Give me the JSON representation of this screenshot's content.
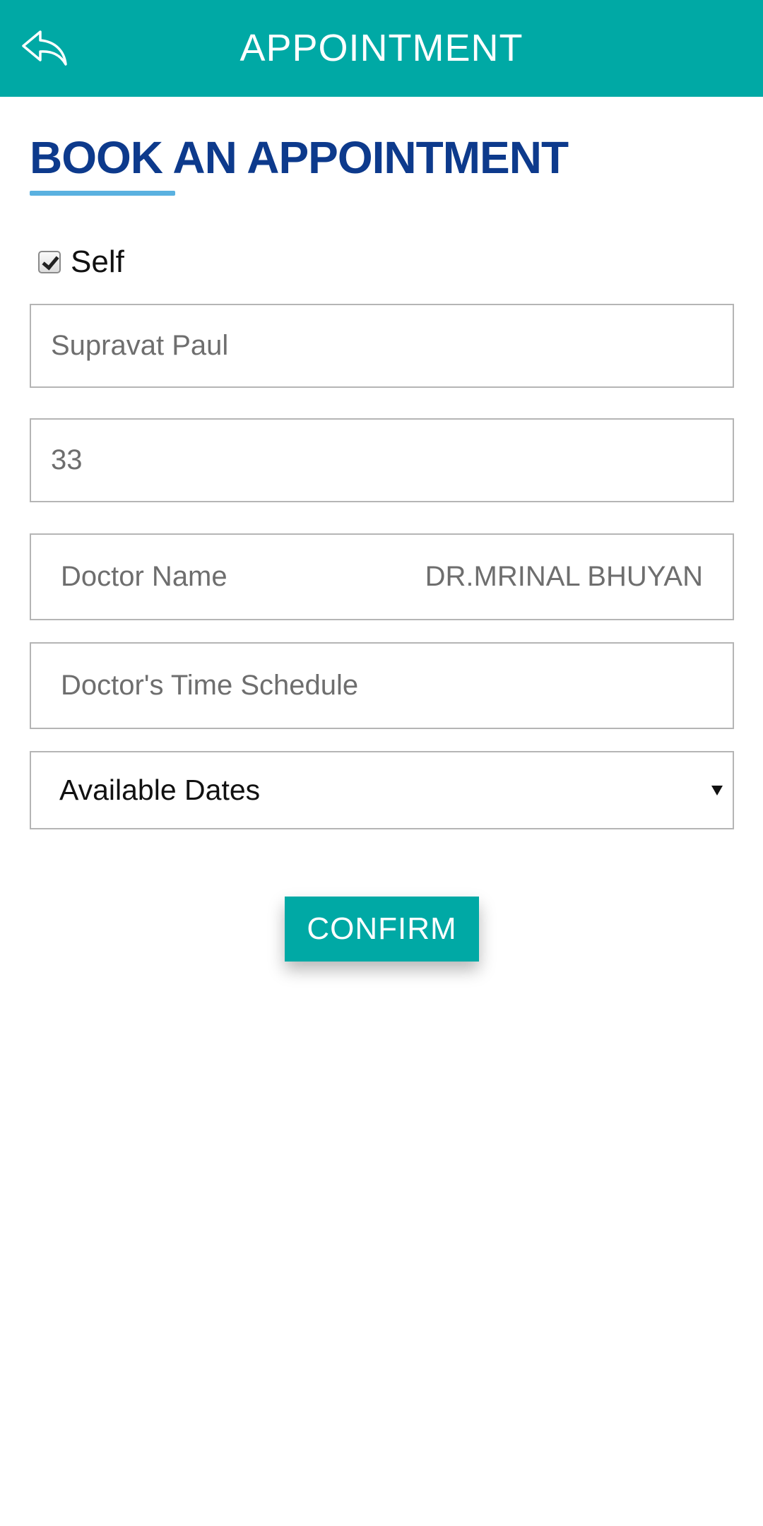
{
  "appbar": {
    "title": "APPOINTMENT",
    "back_icon": "reply-arrow-icon",
    "background_color": "#00a9a5"
  },
  "form": {
    "heading": "BOOK AN APPOINTMENT",
    "heading_color": "#0d3a8c",
    "underline_color": "#5ab1e0",
    "self_checkbox": {
      "label": "Self",
      "checked": true
    },
    "patient_name": "Supravat Paul",
    "patient_age": "33",
    "doctor_name": {
      "label": "Doctor Name",
      "value": "DR.MRINAL BHUYAN"
    },
    "doctor_schedule": {
      "label": "Doctor's Time Schedule"
    },
    "available_dates": {
      "selected": "Available Dates"
    }
  },
  "confirm_button": {
    "label": "CONFIRM",
    "color": "#00a9a5"
  }
}
